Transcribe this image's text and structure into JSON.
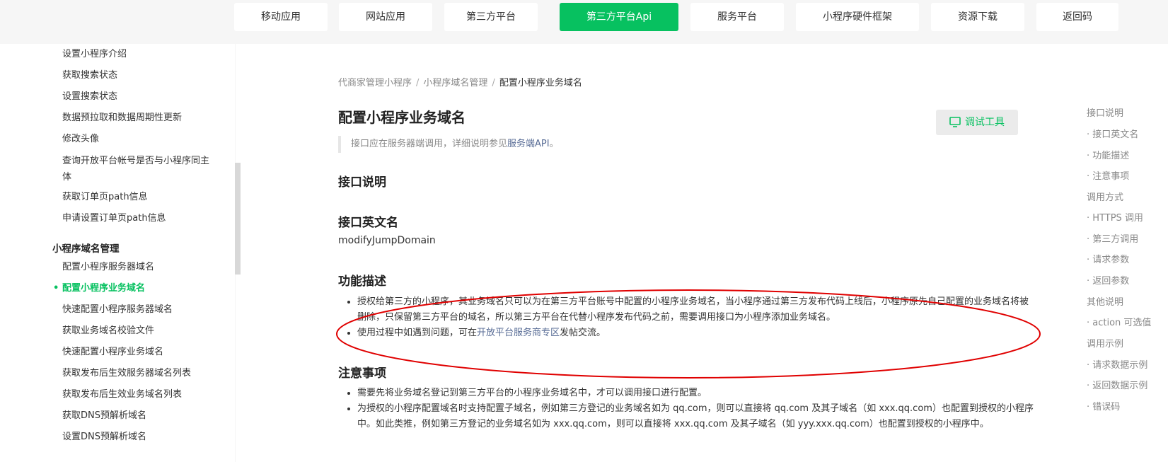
{
  "topnav": {
    "tabs": [
      {
        "label": "移动应用",
        "active": false
      },
      {
        "label": "网站应用",
        "active": false
      },
      {
        "label": "第三方平台",
        "active": false
      },
      {
        "label": "第三方平台Api",
        "active": true
      },
      {
        "label": "服务平台",
        "active": false
      },
      {
        "label": "小程序硬件框架",
        "active": false
      },
      {
        "label": "资源下载",
        "active": false
      },
      {
        "label": "返回码",
        "active": false
      }
    ]
  },
  "sidebar": {
    "items_top": [
      "设置小程序介绍",
      "获取搜索状态",
      "设置搜索状态",
      "数据预拉取和数据周期性更新",
      "修改头像",
      "查询开放平台帐号是否与小程序同主体",
      "获取订单页path信息",
      "申请设置订单页path信息"
    ],
    "group": "小程序域名管理",
    "items_bottom": [
      "配置小程序服务器域名",
      "配置小程序业务域名",
      "快速配置小程序服务器域名",
      "获取业务域名校验文件",
      "快速配置小程序业务域名",
      "获取发布后生效服务器域名列表",
      "获取发布后生效业务域名列表",
      "获取DNS预解析域名",
      "设置DNS预解析域名"
    ],
    "active_bullet": "•"
  },
  "breadcrumb": {
    "a": "代商家管理小程序",
    "b": "小程序域名管理",
    "c": "配置小程序业务域名",
    "sep": "/"
  },
  "main": {
    "title": "配置小程序业务域名",
    "debug_label": "调试工具",
    "note_text": "接口应在服务器端调用，详细说明参见",
    "note_link": "服务端API",
    "note_end": "。",
    "h_interface": "接口说明",
    "h_english": "接口英文名",
    "english_name": "modifyJumpDomain",
    "h_function": "功能描述",
    "func_1": "授权给第三方的小程序，其业务域名只可以为在第三方平台账号中配置的小程序业务域名，当小程序通过第三方发布代码上线后，小程序原先自己配置的业务域名将被删除，只保留第三方平台的域名，所以第三方平台在代替小程序发布代码之前，需要调用接口为小程序添加业务域名。",
    "func_2_pre": "使用过程中如遇到问题，可在",
    "func_2_link": "开放平台服务商专区",
    "func_2_post": "发帖交流。",
    "h_notice": "注意事项",
    "notice_1": "需要先将业务域名登记到第三方平台的小程序业务域名中，才可以调用接口进行配置。",
    "notice_2": "为授权的小程序配置域名时支持配置子域名，例如第三方登记的业务域名如为 qq.com，则可以直接将 qq.com 及其子域名（如 xxx.qq.com）也配置到授权的小程序中。如此类推，例如第三方登记的业务域名如为 xxx.qq.com，则可以直接将 xxx.qq.com 及其子域名（如 yyy.xxx.qq.com）也配置到授权的小程序中。"
  },
  "toc": [
    "接口说明",
    "· 接口英文名",
    "· 功能描述",
    "· 注意事项",
    "调用方式",
    "· HTTPS 调用",
    "· 第三方调用",
    "· 请求参数",
    "· 返回参数",
    "其他说明",
    "· action 可选值",
    "调用示例",
    "· 请求数据示例",
    "· 返回数据示例",
    "· 错误码"
  ],
  "colors": {
    "accent": "#07c160",
    "link": "#576b95",
    "annotation": "#e00000"
  }
}
